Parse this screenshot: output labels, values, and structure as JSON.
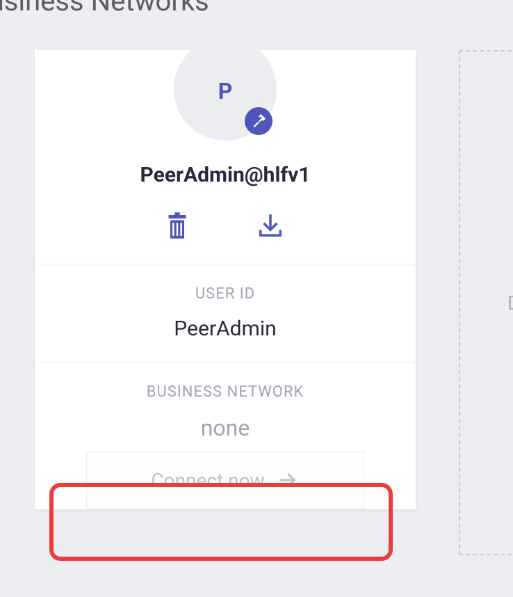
{
  "page": {
    "title": "My Business Networks"
  },
  "card": {
    "avatar_letter": "P",
    "title": "PeerAdmin@hlfv1",
    "user_id_label": "USER ID",
    "user_id_value": "PeerAdmin",
    "business_network_label": "BUSINESS NETWORK",
    "business_network_value": "none",
    "connect_label": "Connect now"
  },
  "placeholder": {
    "letter": "D"
  },
  "colors": {
    "accent": "#4f56b9",
    "highlight": "#ee3b3b",
    "muted": "#a2a4b4",
    "text": "#28283e"
  }
}
